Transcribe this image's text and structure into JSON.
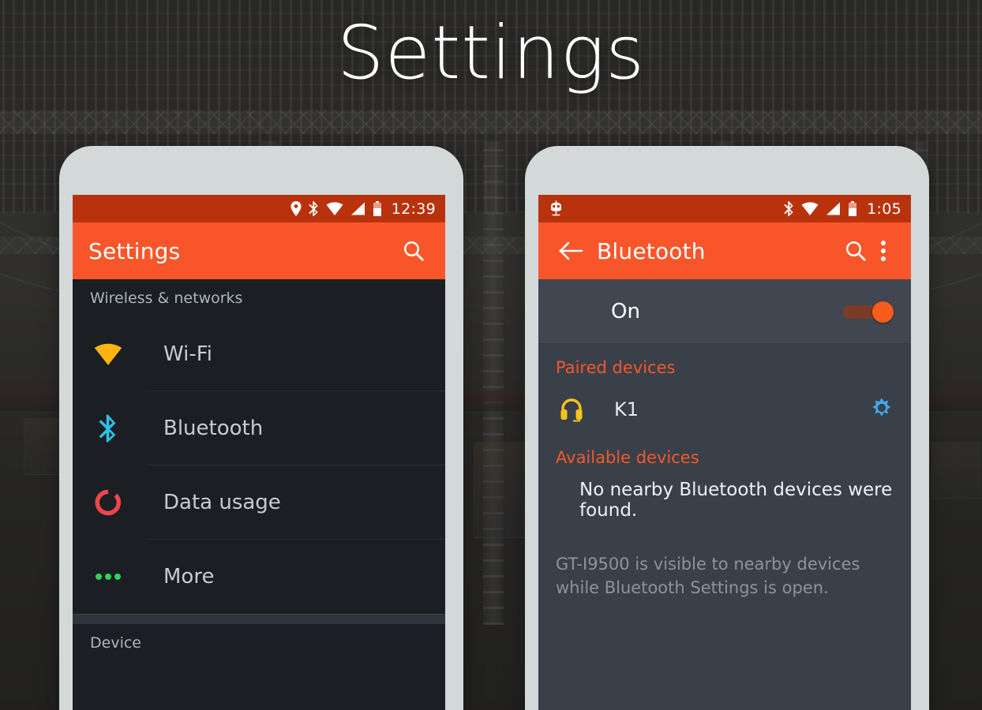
{
  "page": {
    "title": "Settings",
    "background_description": "steel-hall-photo"
  },
  "colors": {
    "status_bar": "#b8330d",
    "toolbar": "#f8562a",
    "accent": "#f2582a",
    "left_screen_bg": "#1b1e23",
    "right_screen_bg": "#3a4049",
    "bezel": "#d3d8d9",
    "wifi_icon": "#ffb412",
    "bluetooth_icon": "#2bc3e8",
    "data_usage_icon": "#f0444c",
    "more_icon": "#30d158",
    "headset_icon": "#f5c518",
    "gear_icon": "#3fa9f5"
  },
  "left_phone": {
    "status_bar": {
      "icons": [
        "location-pin-icon",
        "bluetooth-icon",
        "wifi-icon",
        "signal-icon",
        "battery-icon"
      ],
      "time": "12:39"
    },
    "toolbar": {
      "title": "Settings",
      "search_label": "search-icon"
    },
    "sections": [
      {
        "header": "Wireless & networks",
        "items": [
          {
            "label": "Wi-Fi",
            "icon": "wifi-icon"
          },
          {
            "label": "Bluetooth",
            "icon": "bluetooth-icon"
          },
          {
            "label": "Data usage",
            "icon": "data-usage-icon"
          },
          {
            "label": "More",
            "icon": "more-icon"
          }
        ]
      },
      {
        "header": "Device",
        "items": []
      }
    ]
  },
  "right_phone": {
    "status_bar": {
      "left_icons": [
        "cyanogenmod-icon"
      ],
      "icons": [
        "bluetooth-icon",
        "wifi-icon",
        "signal-icon",
        "battery-icon"
      ],
      "time": "1:05"
    },
    "toolbar": {
      "back_label": "back-arrow-icon",
      "title": "Bluetooth",
      "search_label": "search-icon",
      "overflow_label": "overflow-menu-icon"
    },
    "switch": {
      "label": "On",
      "state": "on"
    },
    "paired": {
      "title": "Paired devices",
      "devices": [
        {
          "name": "K1",
          "icon": "headset-icon",
          "settings_icon": "gear-icon"
        }
      ]
    },
    "available": {
      "title": "Available devices",
      "empty_message": "No nearby Bluetooth devices were found."
    },
    "footer_note": "GT-I9500 is visible to nearby devices while Bluetooth Settings is open."
  }
}
